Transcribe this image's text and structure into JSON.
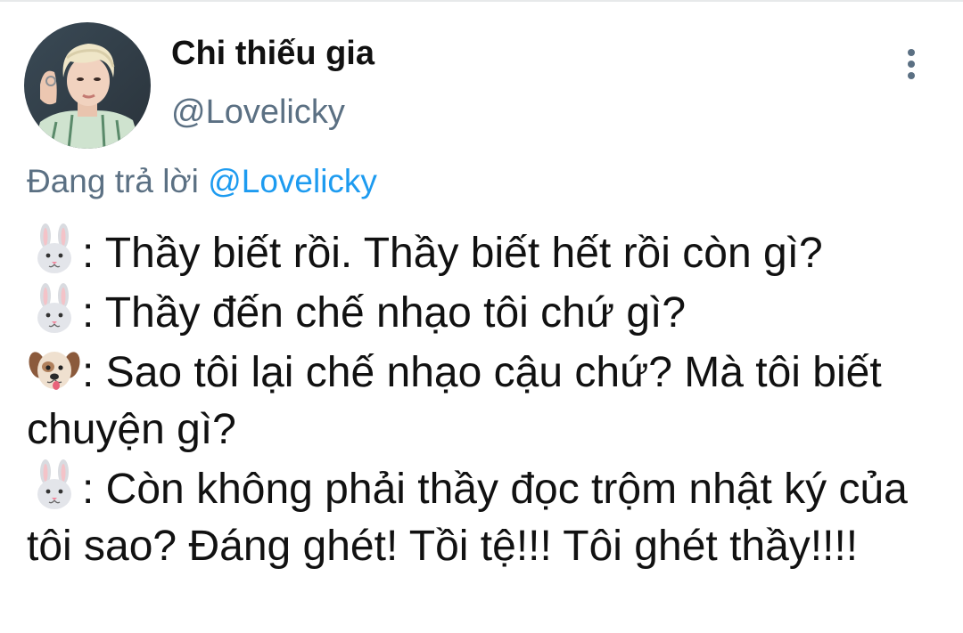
{
  "tweet": {
    "author": {
      "display_name": "Chi thiếu gia",
      "handle": "@Lovelicky"
    },
    "reply_context": {
      "prefix": "Đang trả lời ",
      "mention": "@Lovelicky"
    },
    "lines": [
      {
        "emoji": "rabbit-face-icon",
        "text": ": Thầy biết rồi. Thầy biết hết rồi còn gì?"
      },
      {
        "emoji": "rabbit-face-icon",
        "text": ": Thầy đến chế nhạo tôi chứ gì?"
      },
      {
        "emoji": "dog-face-icon",
        "text": ": Sao tôi lại chế nhạo cậu chứ? Mà tôi biết chuyện gì?"
      },
      {
        "emoji": "rabbit-face-icon",
        "text": ": Còn không phải thầy đọc trộm nhật ký của tôi sao? Đáng ghét! Tồi tệ!!! Tôi ghét thầy!!!!"
      }
    ]
  },
  "colors": {
    "text": "#111111",
    "secondary": "#5b7083",
    "link": "#1d9bf0"
  },
  "icons": {
    "more": "more-vertical-icon"
  }
}
